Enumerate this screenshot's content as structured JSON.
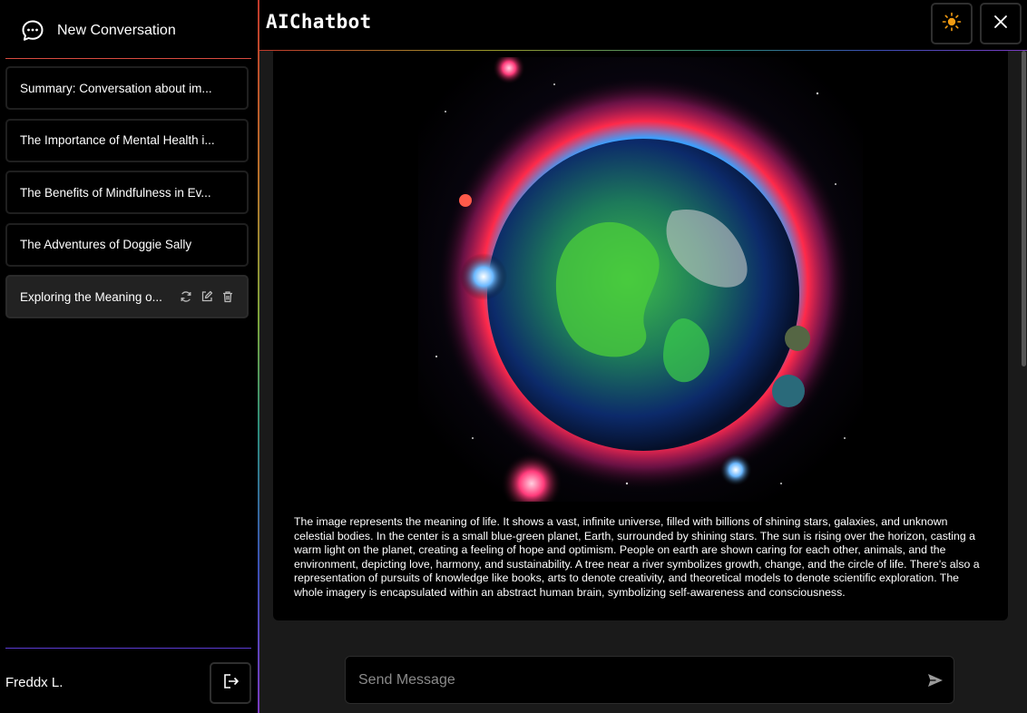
{
  "app": {
    "title": "AIChatbot"
  },
  "sidebar": {
    "new_conversation_label": "New Conversation",
    "conversations": [
      {
        "label": "Summary: Conversation about im..."
      },
      {
        "label": "The Importance of Mental Health i..."
      },
      {
        "label": "The Benefits of Mindfulness in Ev..."
      },
      {
        "label": "The Adventures of Doggie Sally"
      },
      {
        "label": "Exploring the Meaning o...",
        "active": true
      }
    ],
    "active_actions": [
      "refresh-icon",
      "edit-icon",
      "trash-icon"
    ],
    "user_name": "Freddx L."
  },
  "header": {
    "theme_icon": "sun-icon",
    "close_icon": "close-icon",
    "accent_color": "#f39c12"
  },
  "message": {
    "image_icon": "earth-cosmos-image",
    "text": "The image represents the meaning of life. It shows a vast, infinite universe, filled with billions of shining stars, galaxies, and unknown celestial bodies. In the center is a small blue-green planet, Earth, surrounded by shining stars. The sun is rising over the horizon, casting a warm light on the planet, creating a feeling of hope and optimism. People on earth are shown caring for each other, animals, and the environment, depicting love, harmony, and sustainability. A tree near a river symbolizes growth, change, and the circle of life. There's also a representation of pursuits of knowledge like books, arts to denote creativity, and theoretical models to denote scientific exploration. The whole imagery is encapsulated within an abstract human brain, symbolizing self-awareness and consciousness."
  },
  "composer": {
    "placeholder": "Send Message",
    "value": "",
    "send_icon": "send-icon"
  }
}
